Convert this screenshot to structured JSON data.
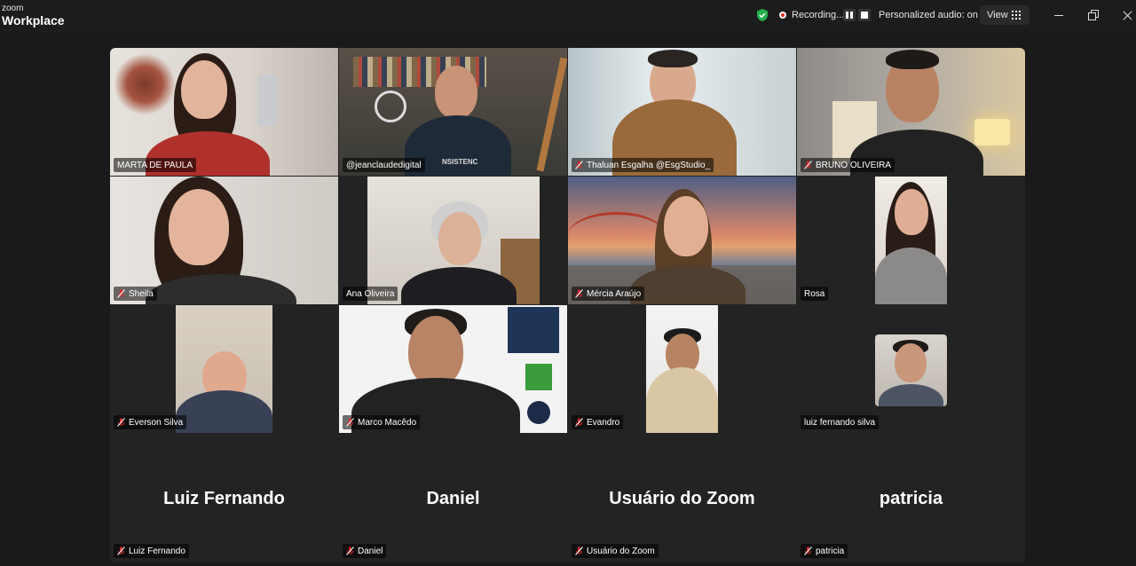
{
  "app": {
    "brand_small": "zoom",
    "brand_large": "Workplace"
  },
  "toolbar": {
    "recording_label": "Recording...",
    "audio_label": "Personalized audio: on",
    "view_label": "View"
  },
  "participants": [
    {
      "name": "MARTA DE PAULA",
      "muted": false
    },
    {
      "name": "@jeanclaudedigital",
      "muted": false,
      "active_speaker": true
    },
    {
      "name": "Thaluan Esgalha @EsgStudio_",
      "muted": true
    },
    {
      "name": "BRUNO OLIVEIRA",
      "muted": true
    },
    {
      "name": "Sheila",
      "muted": true
    },
    {
      "name": "Ana Oliveira",
      "muted": false
    },
    {
      "name": "Mércia Araújo",
      "muted": true
    },
    {
      "name": "Rosa",
      "muted": false
    },
    {
      "name": "Everson Silva",
      "muted": true
    },
    {
      "name": "Marco Macêdo",
      "muted": true
    },
    {
      "name": "Evandro",
      "muted": true
    },
    {
      "name": "luiz fernando silva",
      "muted": false
    },
    {
      "name": "Luiz Fernando",
      "muted": true,
      "display": "Luiz Fernando"
    },
    {
      "name": "Daniel",
      "muted": true,
      "display": "Daniel"
    },
    {
      "name": "Usuário do Zoom",
      "muted": true,
      "display": "Usuário do Zoom"
    },
    {
      "name": "patricia",
      "muted": true,
      "display": "patricia"
    }
  ],
  "colors": {
    "active_border": "#2dc26b",
    "mute_icon": "#e02828",
    "security_shield": "#22b14c"
  },
  "shirt_text": "NSISTENC"
}
